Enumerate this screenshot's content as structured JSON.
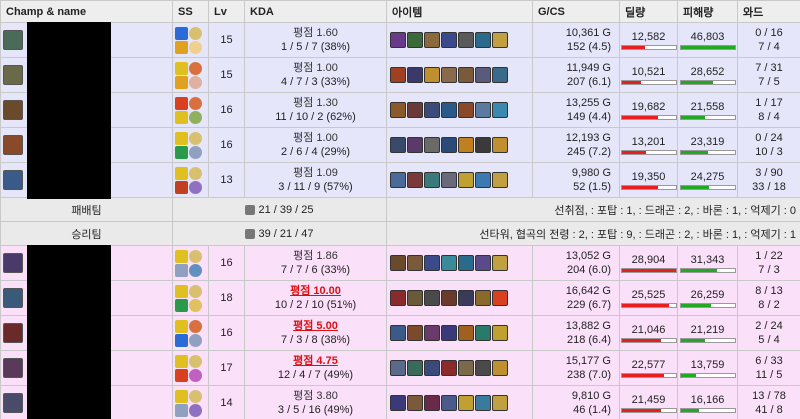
{
  "headers": [
    "Champ & name",
    "SS",
    "Lv",
    "KDA",
    "아이템",
    "G/CS",
    "딜량",
    "피해량",
    "와드"
  ],
  "teams": [
    {
      "key": "loss",
      "label": "패배팀",
      "kda": "21 / 39 / 25",
      "objectives": "선취점, : 포탑 : 1, : 드래곤 : 2, : 바론 : 1, : 억제기 : 0",
      "obj_color": "blue",
      "players": [
        {
          "lv": "15",
          "score": "평점 1.60",
          "score_hi": false,
          "kda": "1 / 5 / 7 (38%)",
          "gold": "10,361 G",
          "cs": "152 (4.5)",
          "dealt": "12,582",
          "dealt_pct": 0.43,
          "taken": "46,803",
          "taken_pct": 1.0,
          "wards_placed": "0 / 16",
          "wards_kills": "7 / 4",
          "champ_color": "#4a6a5a",
          "spells": [
            "#2a6bd8",
            "#e0a020"
          ],
          "runes": [
            "#d8c070",
            "#f0d090"
          ],
          "items": [
            "#6a3a8a",
            "#3a6a3a",
            "#8a6a3a",
            "#3a4a8a",
            "#5a5a5a",
            "#2a6a8a",
            "#c0a040"
          ]
        },
        {
          "lv": "15",
          "score": "평점 1.00",
          "score_hi": false,
          "kda": "4 / 7 / 3 (33%)",
          "gold": "11,949 G",
          "cs": "207 (6.1)",
          "dealt": "10,521",
          "dealt_pct": 0.36,
          "taken": "28,652",
          "taken_pct": 0.61,
          "wards_placed": "7 / 31",
          "wards_kills": "7 / 5",
          "champ_color": "#6a6a4a",
          "spells": [
            "#e0c020",
            "#e0a020"
          ],
          "runes": [
            "#d87040",
            "#e0b0a0"
          ],
          "items": [
            "#a04020",
            "#3a3a6a",
            "#c09030",
            "#8a6a4a",
            "#7a5a3a",
            "#5a5a7a",
            "#3a6a8a"
          ]
        },
        {
          "lv": "16",
          "score": "평점 1.30",
          "score_hi": false,
          "kda": "11 / 10 / 2 (62%)",
          "gold": "13,255 G",
          "cs": "149 (4.4)",
          "dealt": "19,682",
          "dealt_pct": 0.68,
          "taken": "21,558",
          "taken_pct": 0.46,
          "wards_placed": "1 / 17",
          "wards_kills": "8 / 4",
          "champ_color": "#6a4a2a",
          "spells": [
            "#d84020",
            "#e0c020"
          ],
          "runes": [
            "#d87040",
            "#90b060"
          ],
          "items": [
            "#8a5a2a",
            "#6a3a3a",
            "#3a4a7a",
            "#2a5a8a",
            "#8a4a2a",
            "#5a7aa0",
            "#3a8ab0"
          ]
        },
        {
          "lv": "16",
          "score": "평점 1.00",
          "score_hi": false,
          "kda": "2 / 6 / 4 (29%)",
          "gold": "12,193 G",
          "cs": "245 (7.2)",
          "dealt": "13,201",
          "dealt_pct": 0.46,
          "taken": "23,319",
          "taken_pct": 0.5,
          "wards_placed": "0 / 24",
          "wards_kills": "10 / 3",
          "champ_color": "#8a4a2a",
          "spells": [
            "#e0c020",
            "#2a9a4a"
          ],
          "runes": [
            "#d8c070",
            "#90a0c0"
          ],
          "items": [
            "#3a4a6a",
            "#5a3a6a",
            "#6a6a6a",
            "#2a4a7a",
            "#c08020",
            "#3a3a3a",
            "#c09030"
          ]
        },
        {
          "lv": "13",
          "score": "평점 1.09",
          "score_hi": false,
          "kda": "3 / 11 / 9 (57%)",
          "gold": "9,980 G",
          "cs": "52 (1.5)",
          "dealt": "19,350",
          "dealt_pct": 0.67,
          "taken": "24,275",
          "taken_pct": 0.52,
          "wards_placed": "3 / 90",
          "wards_kills": "33 / 18",
          "champ_color": "#3a5a8a",
          "spells": [
            "#e0c020",
            "#c04020"
          ],
          "runes": [
            "#d8c070",
            "#9070c0"
          ],
          "items": [
            "#4a6a9a",
            "#7a3a3a",
            "#3a7a7a",
            "#6a6a7a",
            "#c0a030",
            "#3a7ab0",
            "#c0a040"
          ]
        }
      ]
    },
    {
      "key": "win",
      "label": "승리팀",
      "kda": "39 / 21 / 47",
      "objectives": "선타워, 협곡의 전령 : 2, : 포탑 : 9, : 드래곤 : 2, : 바론 : 1, : 억제기 : 1",
      "obj_color": "red",
      "players": [
        {
          "lv": "16",
          "score": "평점 1.86",
          "score_hi": false,
          "kda": "7 / 7 / 6 (33%)",
          "gold": "13,052 G",
          "cs": "204 (6.0)",
          "dealt": "28,904",
          "dealt_pct": 1.0,
          "taken": "31,343",
          "taken_pct": 0.67,
          "wards_placed": "1 / 22",
          "wards_kills": "7 / 3",
          "champ_color": "#4a3a6a",
          "spells": [
            "#e0c020",
            "#90a0c0"
          ],
          "runes": [
            "#d8c070",
            "#6090c0"
          ],
          "items": [
            "#6a4a2a",
            "#7a5a3a",
            "#3a4a8a",
            "#3a8a9a",
            "#2a6a8a",
            "#5a4a8a",
            "#c0a040"
          ]
        },
        {
          "lv": "18",
          "score": "평점 10.00",
          "score_hi": true,
          "kda": "10 / 2 / 10 (51%)",
          "gold": "16,642 G",
          "cs": "229 (6.7)",
          "dealt": "25,525",
          "dealt_pct": 0.88,
          "taken": "26,259",
          "taken_pct": 0.56,
          "wards_placed": "8 / 13",
          "wards_kills": "8 / 2",
          "champ_color": "#3a5a7a",
          "spells": [
            "#e0c020",
            "#2a9a4a"
          ],
          "runes": [
            "#d8c070",
            "#e0c060"
          ],
          "items": [
            "#8a2a2a",
            "#6a5a3a",
            "#4a4a4a",
            "#6a3a2a",
            "#3a3a5a",
            "#8a6a2a",
            "#d84020"
          ]
        },
        {
          "lv": "16",
          "score": "평점 5.00",
          "score_hi": true,
          "kda": "7 / 3 / 8 (38%)",
          "gold": "13,882 G",
          "cs": "218 (6.4)",
          "dealt": "21,046",
          "dealt_pct": 0.73,
          "taken": "21,219",
          "taken_pct": 0.45,
          "wards_placed": "2 / 24",
          "wards_kills": "5 / 4",
          "champ_color": "#6a2a2a",
          "spells": [
            "#e0c020",
            "#2a6bd8"
          ],
          "runes": [
            "#d87040",
            "#90a0c0"
          ],
          "items": [
            "#3a5a8a",
            "#7a4a2a",
            "#6a3a6a",
            "#3a3a7a",
            "#a06020",
            "#2a7a6a",
            "#c0a030"
          ]
        },
        {
          "lv": "17",
          "score": "평점 4.75",
          "score_hi": true,
          "kda": "12 / 4 / 7 (49%)",
          "gold": "15,177 G",
          "cs": "238 (7.0)",
          "dealt": "22,577",
          "dealt_pct": 0.78,
          "taken": "13,759",
          "taken_pct": 0.29,
          "wards_placed": "6 / 33",
          "wards_kills": "11 / 5",
          "champ_color": "#5a3a5a",
          "spells": [
            "#e0c020",
            "#d84020"
          ],
          "runes": [
            "#d8c070",
            "#c060c0"
          ],
          "items": [
            "#5a6a8a",
            "#3a6a5a",
            "#3a4a7a",
            "#8a2a2a",
            "#7a6a4a",
            "#4a4a4a",
            "#c09030"
          ]
        },
        {
          "lv": "14",
          "score": "평점 3.80",
          "score_hi": false,
          "kda": "3 / 5 / 16 (49%)",
          "gold": "9,810 G",
          "cs": "46 (1.4)",
          "dealt": "21,459",
          "dealt_pct": 0.74,
          "taken": "16,166",
          "taken_pct": 0.34,
          "wards_placed": "13 / 78",
          "wards_kills": "41 / 8",
          "champ_color": "#4a4a6a",
          "spells": [
            "#e0c020",
            "#90a0c0"
          ],
          "runes": [
            "#d8c070",
            "#9070c0"
          ],
          "items": [
            "#3a3a7a",
            "#7a5a3a",
            "#6a2a4a",
            "#4a5a8a",
            "#c0a030",
            "#3a7a9a",
            "#c0a040"
          ]
        }
      ]
    }
  ]
}
